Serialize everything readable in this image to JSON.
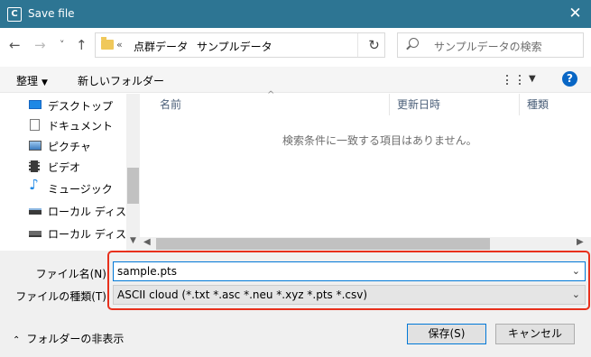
{
  "titlebar": {
    "app_icon": "C",
    "title": "Save file",
    "close": "✕"
  },
  "nav": {
    "back": "←",
    "forward": "→",
    "recent": "˅",
    "up": "↑"
  },
  "address": {
    "chevron": "«",
    "crumbs": [
      "点群データ",
      "サンプルデータ"
    ],
    "separator": "›",
    "refresh": "↻"
  },
  "search": {
    "placeholder": "サンプルデータの検索"
  },
  "toolbar": {
    "organize": "整理",
    "new_folder": "新しいフォルダー",
    "help": "?"
  },
  "sidebar": {
    "items": [
      {
        "label": "デスクトップ",
        "icon": "desktop-icon"
      },
      {
        "label": "ドキュメント",
        "icon": "document-icon"
      },
      {
        "label": "ピクチャ",
        "icon": "picture-icon"
      },
      {
        "label": "ビデオ",
        "icon": "video-icon"
      },
      {
        "label": "ミュージック",
        "icon": "music-icon"
      },
      {
        "label": "ローカル ディスク (C",
        "icon": "drive-icon"
      },
      {
        "label": "ローカル ディスク (D",
        "icon": "drive-icon"
      }
    ]
  },
  "files": {
    "columns": [
      "名前",
      "更新日時",
      "種類"
    ],
    "empty_message": "検索条件に一致する項目はありません。"
  },
  "form": {
    "filename_label": "ファイル名(N):",
    "filename_value": "sample.pts",
    "filetype_label": "ファイルの種類(T):",
    "filetype_value": "ASCII cloud (*.txt *.asc *.neu *.xyz *.pts *.csv)"
  },
  "footer": {
    "hide_folders": "フォルダーの非表示",
    "save_button": "保存(S)",
    "cancel_button": "キャンセル"
  },
  "colors": {
    "titlebar": "#2d7593",
    "highlight": "#e8301c",
    "accent": "#0078d7"
  }
}
